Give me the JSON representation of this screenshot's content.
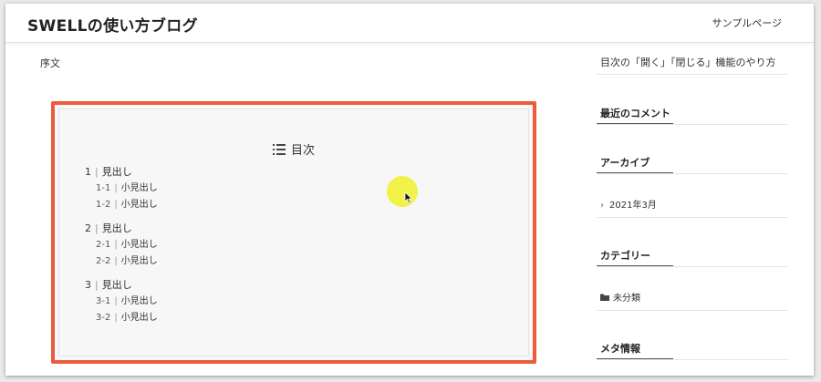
{
  "header": {
    "site_title": "SWELLの使い方ブログ",
    "nav_item": "サンプルページ"
  },
  "main": {
    "intro_text": "序文",
    "toc": {
      "title": "目次",
      "title_icon": "list-icon",
      "groups": [
        {
          "num": "1",
          "label": "見出し",
          "children": [
            {
              "num": "1-1",
              "label": "小見出し"
            },
            {
              "num": "1-2",
              "label": "小見出し"
            }
          ]
        },
        {
          "num": "2",
          "label": "見出し",
          "children": [
            {
              "num": "2-1",
              "label": "小見出し"
            },
            {
              "num": "2-2",
              "label": "小見出し"
            }
          ]
        },
        {
          "num": "3",
          "label": "見出し",
          "children": [
            {
              "num": "3-1",
              "label": "小見出し"
            },
            {
              "num": "3-2",
              "label": "小見出し"
            }
          ]
        }
      ],
      "separator": "|",
      "highlight_color": "#ec5b3d"
    }
  },
  "sidebar": {
    "recent_post": "目次の「開く」「閉じる」機能のやり方",
    "recent_comments_heading": "最近のコメント",
    "archive_heading": "アーカイブ",
    "archive_item": "2021年3月",
    "category_heading": "カテゴリー",
    "category_item": "未分類",
    "meta_heading": "メタ情報"
  }
}
